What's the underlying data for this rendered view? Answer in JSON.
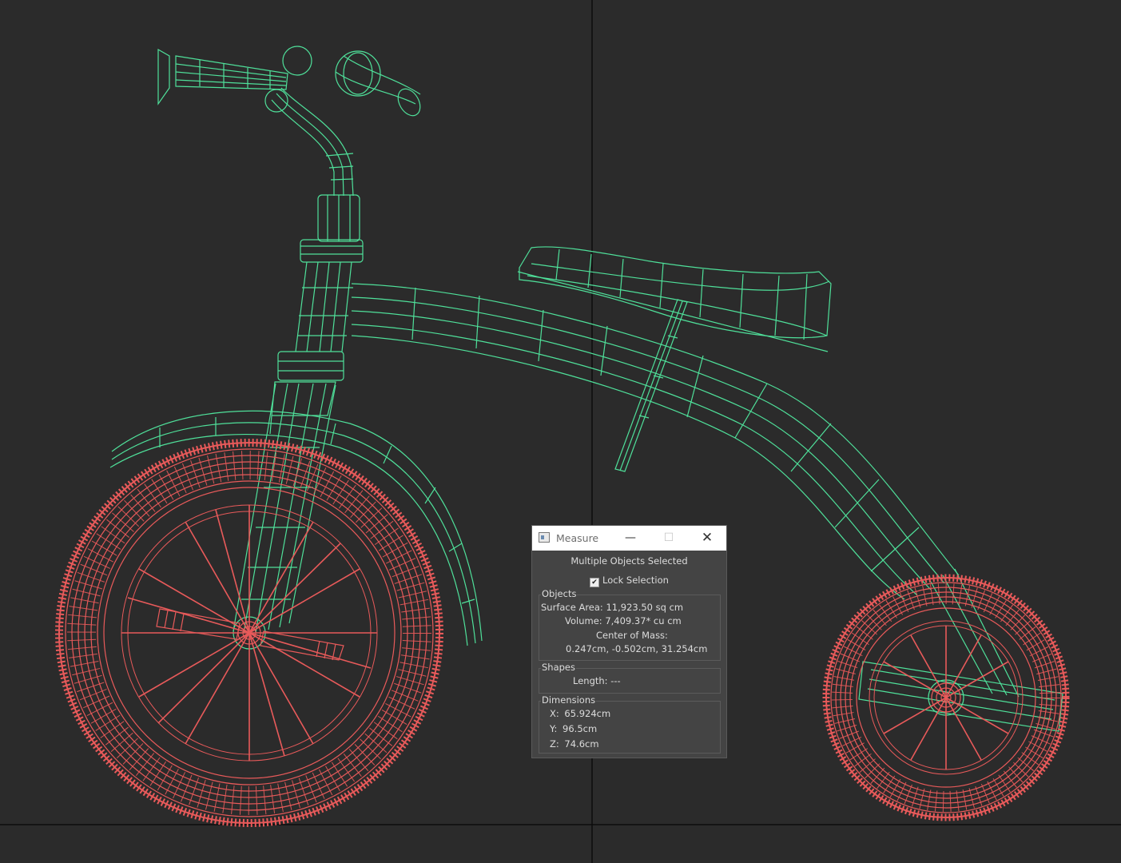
{
  "measure_window": {
    "title": "Measure",
    "header": "Multiple Objects Selected",
    "lock_selection": {
      "label": "Lock Selection",
      "checked": true
    },
    "objects": {
      "label": "Objects",
      "surface_area_label": "Surface Area:",
      "surface_area_value": "11,923.50 sq cm",
      "volume_label": "Volume:",
      "volume_value": "7,409.37* cu cm",
      "center_of_mass_label": "Center of Mass:",
      "center_of_mass_value": "0.247cm, -0.502cm, 31.254cm"
    },
    "shapes": {
      "label": "Shapes",
      "length_label": "Length:",
      "length_value": "---"
    },
    "dimensions": {
      "label": "Dimensions",
      "x_label": "X:",
      "x_value": "65.924cm",
      "y_label": "Y:",
      "y_value": "96.5cm",
      "z_label": "Z:",
      "z_value": "74.6cm"
    }
  },
  "colors": {
    "viewport_bg": "#2b2b2b",
    "wire_green": "#4fe09a",
    "wire_red": "#e85a5a",
    "grid_line": "#0c0c0c"
  }
}
